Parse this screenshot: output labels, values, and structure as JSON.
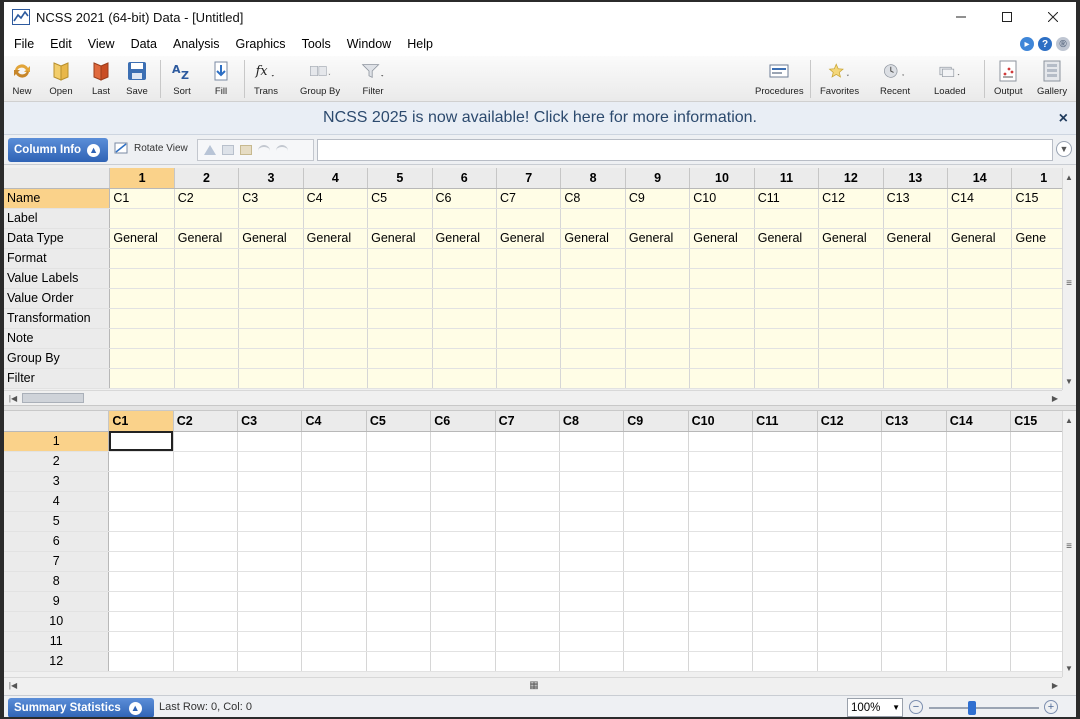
{
  "window": {
    "title": "NCSS 2021 (64-bit) Data - [Untitled]"
  },
  "menu": [
    "File",
    "Edit",
    "View",
    "Data",
    "Analysis",
    "Graphics",
    "Tools",
    "Window",
    "Help"
  ],
  "toolbar": {
    "new": "New",
    "open": "Open",
    "last": "Last",
    "save": "Save",
    "sort": "Sort",
    "fill": "Fill",
    "trans": "Trans",
    "group_by": "Group By",
    "filter": "Filter",
    "procedures": "Procedures",
    "favorites": "Favorites",
    "recent": "Recent",
    "loaded": "Loaded",
    "output": "Output",
    "gallery": "Gallery"
  },
  "banner": {
    "message": "NCSS 2025 is now available! Click here for more information.",
    "close": "×"
  },
  "column_info": {
    "tab_label": "Column Info",
    "rotate_view": "Rotate View"
  },
  "top_grid": {
    "col_numbers": [
      "1",
      "2",
      "3",
      "4",
      "5",
      "6",
      "7",
      "8",
      "9",
      "10",
      "11",
      "12",
      "13",
      "14",
      "1"
    ],
    "row_labels": [
      "Name",
      "Label",
      "Data Type",
      "Format",
      "Value Labels",
      "Value Order",
      "Transformation",
      "Note",
      "Group By",
      "Filter"
    ],
    "names": [
      "C1",
      "C2",
      "C3",
      "C4",
      "C5",
      "C6",
      "C7",
      "C8",
      "C9",
      "C10",
      "C11",
      "C12",
      "C13",
      "C14",
      "C15"
    ],
    "data_types": [
      "General",
      "General",
      "General",
      "General",
      "General",
      "General",
      "General",
      "General",
      "General",
      "General",
      "General",
      "General",
      "General",
      "General",
      "Gene"
    ]
  },
  "bottom_grid": {
    "columns": [
      "C1",
      "C2",
      "C3",
      "C4",
      "C5",
      "C6",
      "C7",
      "C8",
      "C9",
      "C10",
      "C11",
      "C12",
      "C13",
      "C14",
      "C15"
    ],
    "rows": [
      "1",
      "2",
      "3",
      "4",
      "5",
      "6",
      "7",
      "8",
      "9",
      "10",
      "11",
      "12"
    ]
  },
  "status": {
    "summary_tab": "Summary Statistics",
    "last_row": "Last Row: 0, Col: 0",
    "zoom": "100%"
  }
}
